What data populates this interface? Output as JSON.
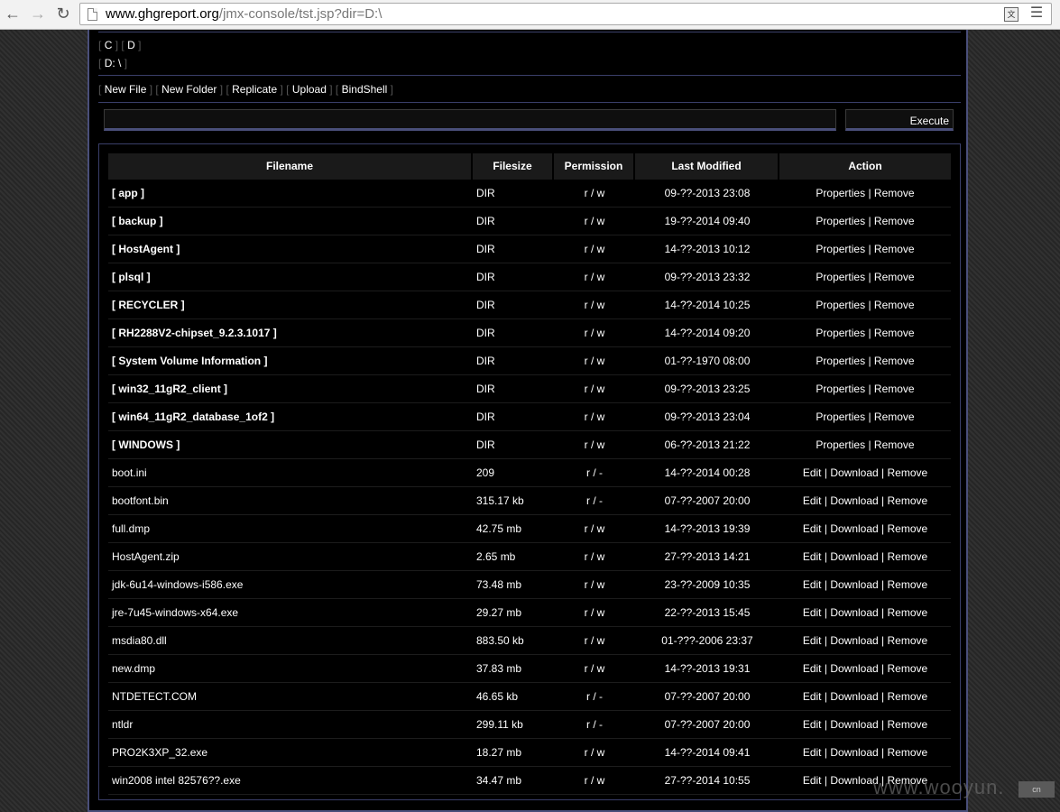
{
  "browser": {
    "back_icon": "back-arrow-icon",
    "forward_icon": "forward-arrow-icon",
    "reload_icon": "reload-icon",
    "url_host": "www.ghgreport.org",
    "url_path": "/jmx-console/tst.jsp?dir=D:\\"
  },
  "drives": {
    "c_label": "C",
    "d_label": "D",
    "current_path": "D: \\"
  },
  "actions": {
    "new_file": "New File",
    "new_folder": "New Folder",
    "replicate": "Replicate",
    "upload": "Upload",
    "bindshell": "BindShell"
  },
  "command": {
    "input_value": "",
    "execute_label": "Execute"
  },
  "table": {
    "headers": {
      "filename": "Filename",
      "filesize": "Filesize",
      "permission": "Permission",
      "last_modified": "Last Modified",
      "action": "Action"
    },
    "rows": [
      {
        "name": "[ app ]",
        "size": "DIR",
        "perm": "r / w",
        "modified": "09-??-2013 23:08",
        "a1": "Properties",
        "a2": "Remove"
      },
      {
        "name": "[ backup ]",
        "size": "DIR",
        "perm": "r / w",
        "modified": "19-??-2014 09:40",
        "a1": "Properties",
        "a2": "Remove"
      },
      {
        "name": "[ HostAgent ]",
        "size": "DIR",
        "perm": "r / w",
        "modified": "14-??-2013 10:12",
        "a1": "Properties",
        "a2": "Remove"
      },
      {
        "name": "[ plsql ]",
        "size": "DIR",
        "perm": "r / w",
        "modified": "09-??-2013 23:32",
        "a1": "Properties",
        "a2": "Remove"
      },
      {
        "name": "[ RECYCLER ]",
        "size": "DIR",
        "perm": "r / w",
        "modified": "14-??-2014 10:25",
        "a1": "Properties",
        "a2": "Remove"
      },
      {
        "name": "[ RH2288V2-chipset_9.2.3.1017 ]",
        "size": "DIR",
        "perm": "r / w",
        "modified": "14-??-2014 09:20",
        "a1": "Properties",
        "a2": "Remove"
      },
      {
        "name": "[ System Volume Information ]",
        "size": "DIR",
        "perm": "r / w",
        "modified": "01-??-1970 08:00",
        "a1": "Properties",
        "a2": "Remove"
      },
      {
        "name": "[ win32_11gR2_client ]",
        "size": "DIR",
        "perm": "r / w",
        "modified": "09-??-2013 23:25",
        "a1": "Properties",
        "a2": "Remove"
      },
      {
        "name": "[ win64_11gR2_database_1of2 ]",
        "size": "DIR",
        "perm": "r / w",
        "modified": "09-??-2013 23:04",
        "a1": "Properties",
        "a2": "Remove"
      },
      {
        "name": "[ WINDOWS ]",
        "size": "DIR",
        "perm": "r / w",
        "modified": "06-??-2013 21:22",
        "a1": "Properties",
        "a2": "Remove"
      },
      {
        "name": "boot.ini",
        "size": "209",
        "perm": "r / -",
        "modified": "14-??-2014 00:28",
        "a1": "Edit",
        "a2": "Download",
        "a3": "Remove"
      },
      {
        "name": "bootfont.bin",
        "size": "315.17 kb",
        "perm": "r / -",
        "modified": "07-??-2007 20:00",
        "a1": "Edit",
        "a2": "Download",
        "a3": "Remove"
      },
      {
        "name": "full.dmp",
        "size": "42.75 mb",
        "perm": "r / w",
        "modified": "14-??-2013 19:39",
        "a1": "Edit",
        "a2": "Download",
        "a3": "Remove"
      },
      {
        "name": "HostAgent.zip",
        "size": "2.65 mb",
        "perm": "r / w",
        "modified": "27-??-2013 14:21",
        "a1": "Edit",
        "a2": "Download",
        "a3": "Remove"
      },
      {
        "name": "jdk-6u14-windows-i586.exe",
        "size": "73.48 mb",
        "perm": "r / w",
        "modified": "23-??-2009 10:35",
        "a1": "Edit",
        "a2": "Download",
        "a3": "Remove"
      },
      {
        "name": "jre-7u45-windows-x64.exe",
        "size": "29.27 mb",
        "perm": "r / w",
        "modified": "22-??-2013 15:45",
        "a1": "Edit",
        "a2": "Download",
        "a3": "Remove"
      },
      {
        "name": "msdia80.dll",
        "size": "883.50 kb",
        "perm": "r / w",
        "modified": "01-???-2006 23:37",
        "a1": "Edit",
        "a2": "Download",
        "a3": "Remove"
      },
      {
        "name": "new.dmp",
        "size": "37.83 mb",
        "perm": "r / w",
        "modified": "14-??-2013 19:31",
        "a1": "Edit",
        "a2": "Download",
        "a3": "Remove"
      },
      {
        "name": "NTDETECT.COM",
        "size": "46.65 kb",
        "perm": "r / -",
        "modified": "07-??-2007 20:00",
        "a1": "Edit",
        "a2": "Download",
        "a3": "Remove"
      },
      {
        "name": "ntldr",
        "size": "299.11 kb",
        "perm": "r / -",
        "modified": "07-??-2007 20:00",
        "a1": "Edit",
        "a2": "Download",
        "a3": "Remove"
      },
      {
        "name": "PRO2K3XP_32.exe",
        "size": "18.27 mb",
        "perm": "r / w",
        "modified": "14-??-2014 09:41",
        "a1": "Edit",
        "a2": "Download",
        "a3": "Remove"
      },
      {
        "name": "win2008 intel 82576??.exe",
        "size": "34.47 mb",
        "perm": "r / w",
        "modified": "27-??-2014 10:55",
        "a1": "Edit",
        "a2": "Download",
        "a3": "Remove"
      }
    ]
  },
  "watermark": {
    "text": "www.wooyun.",
    "box_text": "cn"
  }
}
